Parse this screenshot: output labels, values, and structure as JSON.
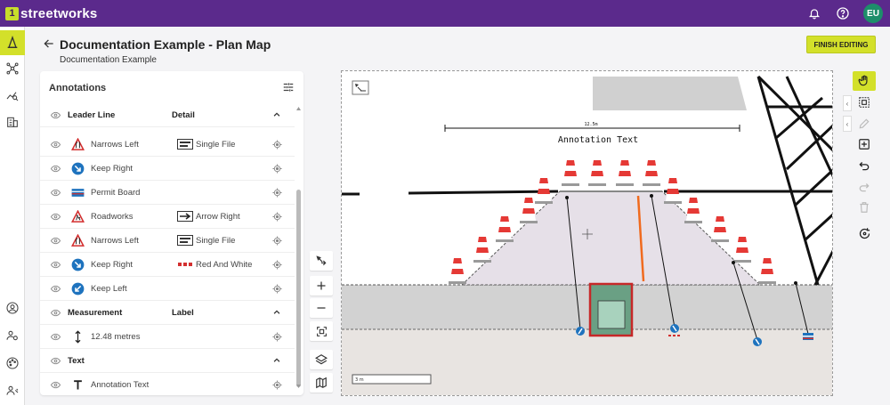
{
  "app": {
    "logo_mark": "1",
    "logo_text": "streetworks",
    "avatar_initials": "EU"
  },
  "page": {
    "title": "Documentation Example - Plan Map",
    "subtitle": "Documentation Example",
    "finish_label": "FINISH EDITING"
  },
  "panel": {
    "title": "Annotations",
    "groups": [
      {
        "label": "Leader Line",
        "detail_header": "Detail",
        "rows": [
          {
            "label": "Narrows Left",
            "detail": "Single File",
            "icon": "narrows-left-sign-icon",
            "detail_icon": "single-file-icon"
          },
          {
            "label": "Keep Right",
            "detail": "",
            "icon": "keep-right-sign-icon"
          },
          {
            "label": "Permit Board",
            "detail": "",
            "icon": "permit-board-icon"
          },
          {
            "label": "Roadworks",
            "detail": "Arrow Right",
            "icon": "roadworks-sign-icon",
            "detail_icon": "arrow-right-icon"
          },
          {
            "label": "Narrows Left",
            "detail": "Single File",
            "icon": "narrows-left-sign-icon",
            "detail_icon": "single-file-icon"
          },
          {
            "label": "Keep Right",
            "detail": "Red And White",
            "icon": "keep-right-sign-icon",
            "detail_icon": "red-white-icon"
          },
          {
            "label": "Keep Left",
            "detail": "",
            "icon": "keep-left-sign-icon"
          }
        ]
      },
      {
        "label": "Measurement",
        "detail_header": "Label",
        "rows": [
          {
            "label": "12.48 metres",
            "detail": "",
            "icon": "measure-icon"
          }
        ]
      },
      {
        "label": "Text",
        "detail_header": "",
        "rows": [
          {
            "label": "Annotation Text",
            "detail": "",
            "icon": "text-icon"
          }
        ]
      }
    ]
  },
  "map": {
    "measure_label": "12.5m",
    "annotation_text": "Annotation Text",
    "scale_label": "3 m"
  },
  "colors": {
    "brand": "#5b2a8c",
    "accent": "#d3e02a",
    "cone": "#e53935",
    "highlight_box": "#d32f2f"
  }
}
